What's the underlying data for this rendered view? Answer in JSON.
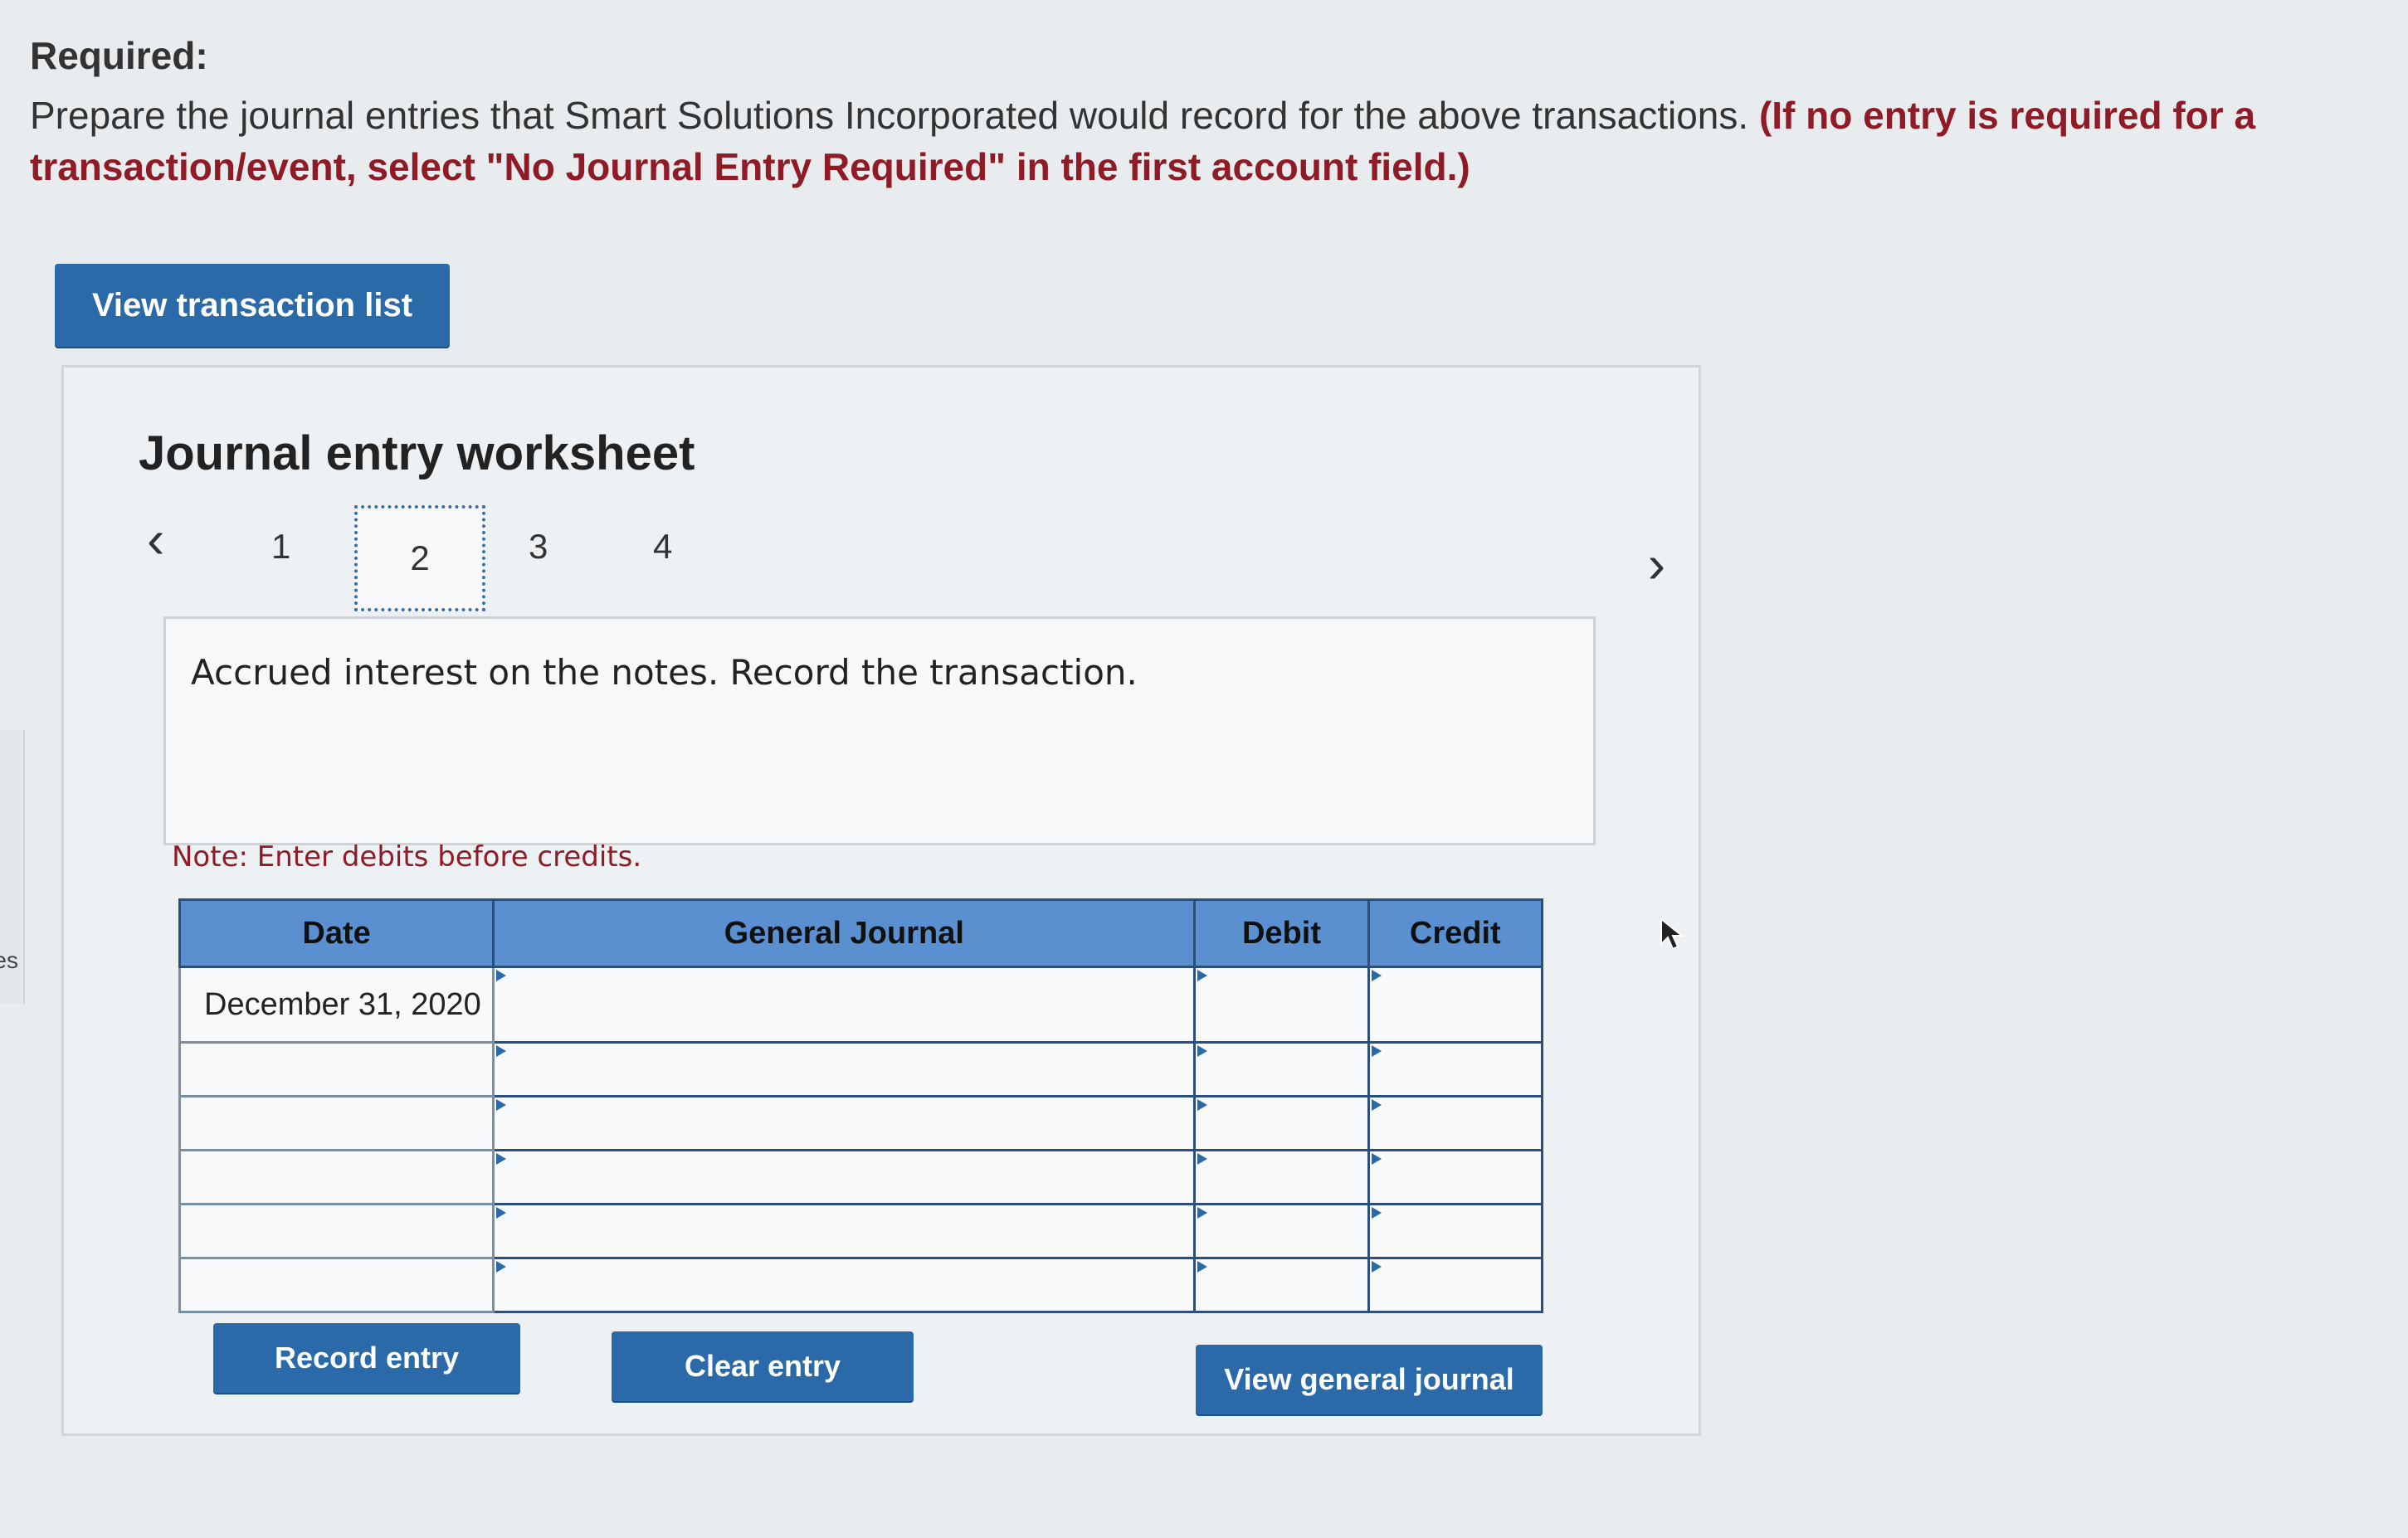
{
  "sidebar_fragment": {
    "text": "es"
  },
  "required": {
    "title": "Required:",
    "instruction": "Prepare the journal entries that Smart Solutions Incorporated would record for the above transactions.",
    "emphasis": "(If no entry is required for a transaction/event, select \"No Journal Entry Required\" in the first account field.)"
  },
  "buttons": {
    "view_transaction_list": "View transaction list",
    "record_entry": "Record entry",
    "clear_entry": "Clear entry",
    "view_general_journal": "View general journal"
  },
  "worksheet": {
    "title": "Journal entry worksheet",
    "pages": [
      "1",
      "2",
      "3",
      "4"
    ],
    "current_page": "2",
    "prompt": "Accrued interest on the notes. Record the transaction.",
    "note": "Note: Enter debits before credits."
  },
  "table": {
    "headers": {
      "date": "Date",
      "journal": "General Journal",
      "debit": "Debit",
      "credit": "Credit"
    },
    "rows": [
      {
        "date": "December 31, 2020",
        "account": "",
        "debit": "",
        "credit": ""
      },
      {
        "date": "",
        "account": "",
        "debit": "",
        "credit": ""
      },
      {
        "date": "",
        "account": "",
        "debit": "",
        "credit": ""
      },
      {
        "date": "",
        "account": "",
        "debit": "",
        "credit": ""
      },
      {
        "date": "",
        "account": "",
        "debit": "",
        "credit": ""
      },
      {
        "date": "",
        "account": "",
        "debit": "",
        "credit": ""
      }
    ]
  },
  "colors": {
    "accent": "#2b6aa8",
    "header_bg": "#5a8fd0",
    "emphasis_red": "#8e1b26"
  },
  "icons": {
    "prev": "chevron-left-icon",
    "next": "chevron-right-icon",
    "pointer": "mouse-pointer-icon"
  }
}
